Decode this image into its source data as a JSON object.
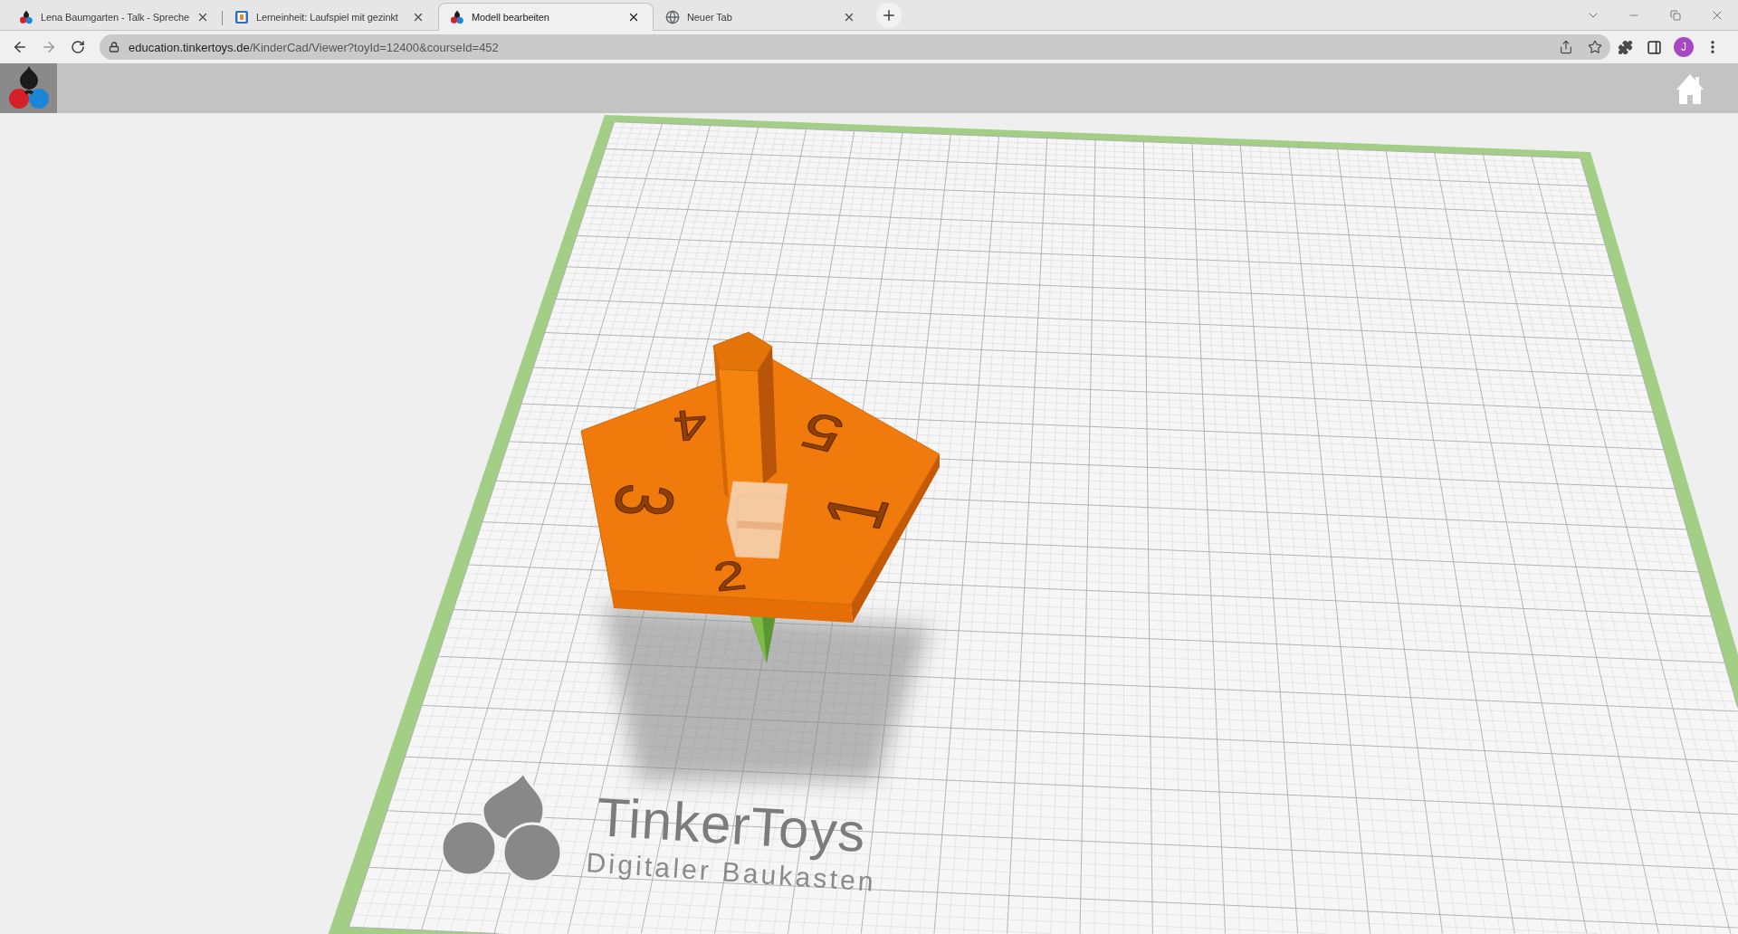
{
  "browser": {
    "tabs": [
      {
        "kind": "tinkertoys",
        "title": "Lena Baumgarten - Talk - Spreche",
        "selected": false
      },
      {
        "kind": "course",
        "title": "Lerneinheit: Laufspiel mit gezinkt",
        "selected": false
      },
      {
        "kind": "tinkertoys",
        "title": "Modell bearbeiten",
        "selected": true
      },
      {
        "kind": "globe",
        "title": "Neuer Tab",
        "selected": false
      }
    ],
    "url": {
      "host": "education.tinkertoys.de",
      "path": "/KinderCad/Viewer?toyId=12400&courseId=452"
    },
    "profile": {
      "initial": "J"
    }
  },
  "viewer": {
    "model_digits": [
      "4",
      "5",
      "3",
      "1",
      "2"
    ],
    "floor_logo": {
      "title": "TinkerToys",
      "subtitle": "Digitaler Baukasten"
    }
  }
}
